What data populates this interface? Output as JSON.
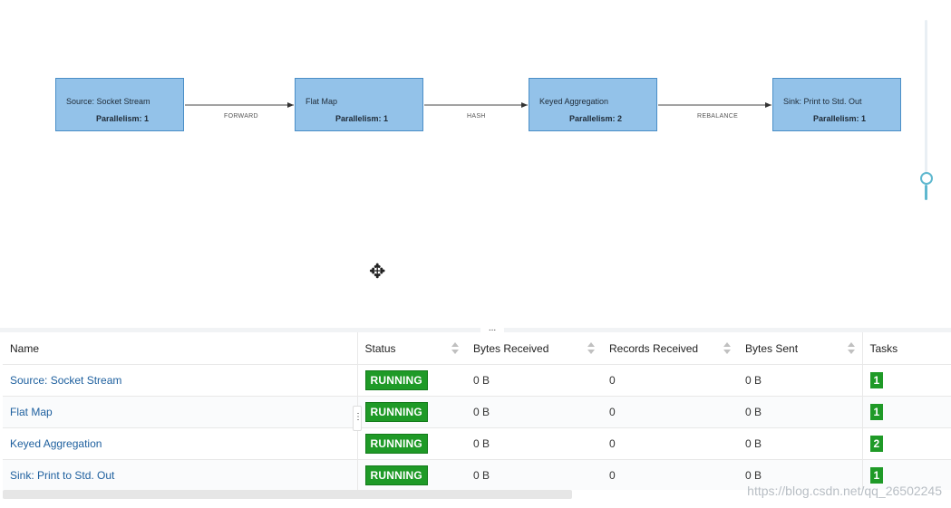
{
  "graph": {
    "nodes": [
      {
        "name": "Source: Socket Stream",
        "parallelism": "Parallelism: 1"
      },
      {
        "name": "Flat Map",
        "parallelism": "Parallelism: 1"
      },
      {
        "name": "Keyed Aggregation",
        "parallelism": "Parallelism: 2"
      },
      {
        "name": "Sink: Print to Std. Out",
        "parallelism": "Parallelism: 1"
      }
    ],
    "edges": [
      {
        "label": "FORWARD"
      },
      {
        "label": "HASH"
      },
      {
        "label": "REBALANCE"
      }
    ],
    "colors": {
      "node_fill": "#93c2e9",
      "node_border": "#4a8ec7",
      "zoom_accent": "#5fb8cf"
    }
  },
  "splitter": {
    "handle": "..."
  },
  "table": {
    "headers": {
      "name": "Name",
      "status": "Status",
      "bytes_received": "Bytes Received",
      "records_received": "Records Received",
      "bytes_sent": "Bytes Sent",
      "tasks": "Tasks"
    },
    "rows": [
      {
        "name": "Source: Socket Stream",
        "status": "RUNNING",
        "bytes_received": "0 B",
        "records_received": "0",
        "bytes_sent": "0 B",
        "tasks": "1"
      },
      {
        "name": "Flat Map",
        "status": "RUNNING",
        "bytes_received": "0 B",
        "records_received": "0",
        "bytes_sent": "0 B",
        "tasks": "1"
      },
      {
        "name": "Keyed Aggregation",
        "status": "RUNNING",
        "bytes_received": "0 B",
        "records_received": "0",
        "bytes_sent": "0 B",
        "tasks": "2"
      },
      {
        "name": "Sink: Print to Std. Out",
        "status": "RUNNING",
        "bytes_received": "0 B",
        "records_received": "0",
        "bytes_sent": "0 B",
        "tasks": "1"
      }
    ],
    "status_color": "#1f9a27",
    "row_handle": "⋮"
  },
  "icons": {
    "move_cursor": "move-cursor-icon",
    "sort": "sort-icon"
  },
  "watermark": "https://blog.csdn.net/qq_26502245"
}
